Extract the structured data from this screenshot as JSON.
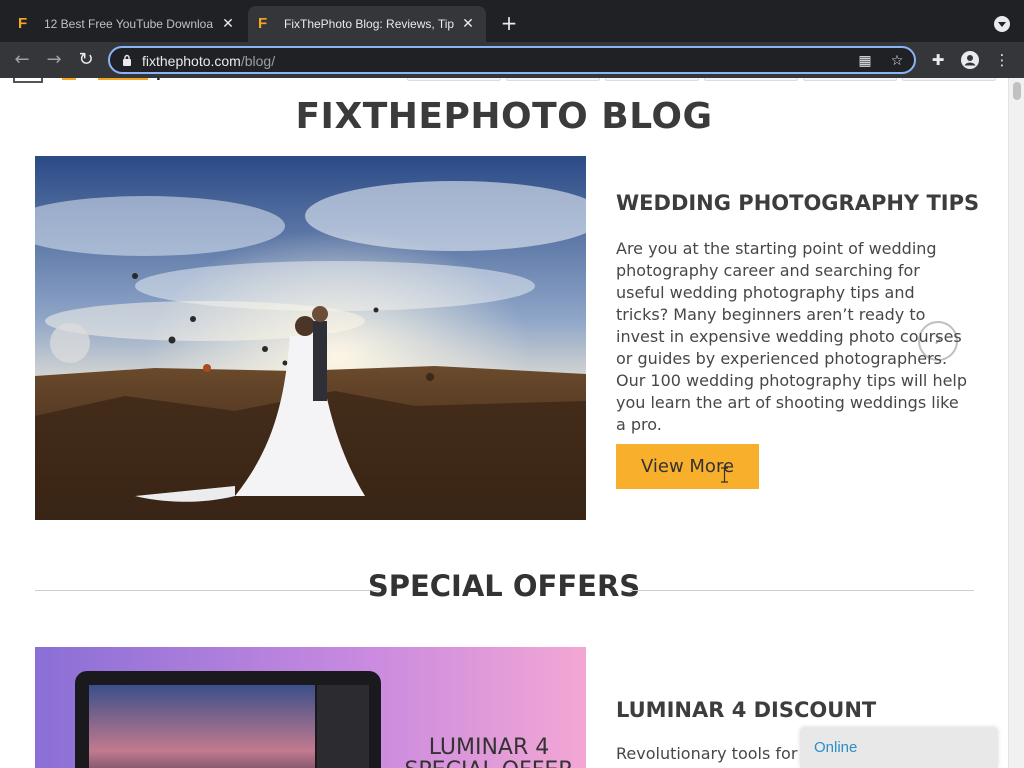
{
  "browser": {
    "tabs": [
      {
        "title": "12 Best Free YouTube Downloa",
        "favicon": "F",
        "active": false
      },
      {
        "title": "FixThePhoto Blog: Reviews, Tip",
        "favicon": "F",
        "active": true
      }
    ],
    "new_tab_label": "+",
    "url_host": "fixthephoto.com",
    "url_path": "/blog/",
    "accent_color": "#8ab4f8"
  },
  "page": {
    "blog_title": "FIXTHEPHOTO BLOG",
    "featured_post": {
      "title": "WEDDING PHOTOGRAPHY TIPS",
      "excerpt": "Are you at the starting point of wedding photography career and searching for useful wedding photography tips and tricks? Many beginners aren’t ready to invest in expensive wedding photo  courses or guides by experienced photographers. Our 100 wedding photography tips will help you learn the art of shooting weddings like a pro.",
      "button_label": "View More",
      "button_color": "#f8af2c"
    },
    "section_title": "SPECIAL OFFERS",
    "offer": {
      "title": "LUMINAR 4 DISCOUNT",
      "excerpt": "Revolutionary tools for re",
      "image_text_line1": "LUMINAR 4",
      "image_text_line2": "SPECIAL OFFER"
    },
    "chat_status": "Online"
  }
}
